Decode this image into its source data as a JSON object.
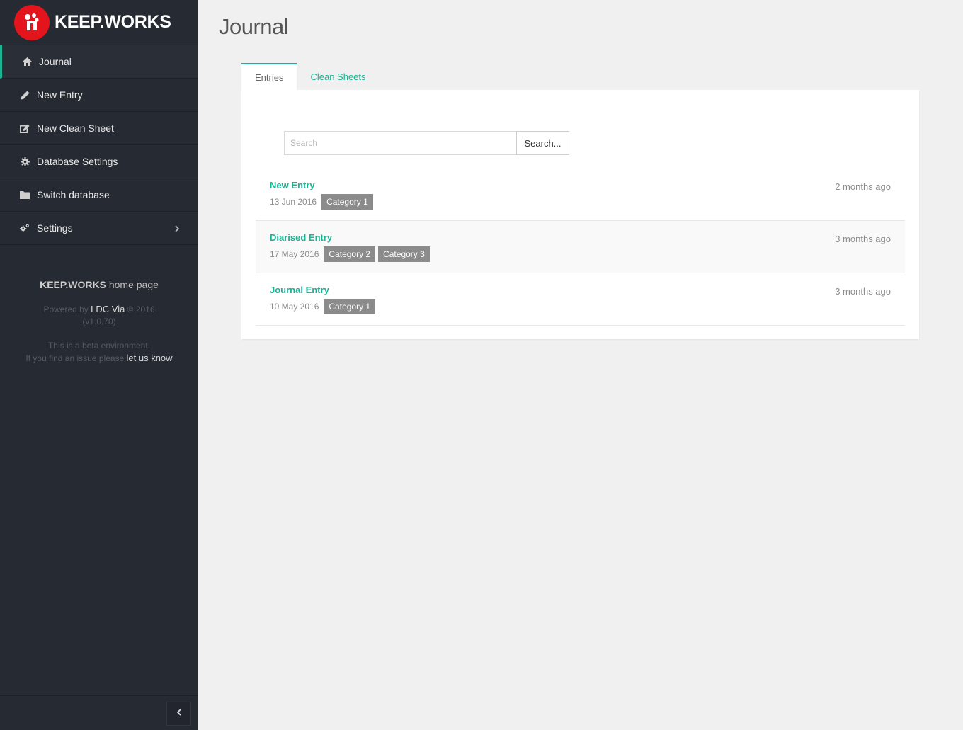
{
  "brand": {
    "name": "KEEP.WORKS"
  },
  "sidebar": {
    "items": [
      {
        "label": "Journal",
        "icon": "home-icon"
      },
      {
        "label": "New Entry",
        "icon": "pencil-icon"
      },
      {
        "label": "New Clean Sheet",
        "icon": "edit-icon"
      },
      {
        "label": "Database Settings",
        "icon": "gear-icon"
      },
      {
        "label": "Switch database",
        "icon": "folder-icon"
      },
      {
        "label": "Settings",
        "icon": "gears-icon"
      }
    ],
    "footer": {
      "home_brand": "KEEP.WORKS",
      "home_text": " home page",
      "powered_prefix": "Powered by ",
      "powered_link": "LDC Via",
      "powered_suffix": " © 2016",
      "version": "(v1.0.70)",
      "beta_line": "This is a beta environment.",
      "issue_prefix": "If you find an issue please ",
      "issue_link": "let us know"
    }
  },
  "main": {
    "title": "Journal",
    "tabs": [
      {
        "label": "Entries",
        "active": true
      },
      {
        "label": "Clean Sheets",
        "active": false
      }
    ],
    "search": {
      "placeholder": "Search",
      "button_label": "Search..."
    },
    "entries": [
      {
        "title": "New Entry",
        "date": "13 Jun 2016",
        "categories": [
          "Category 1"
        ],
        "age": "2 months ago"
      },
      {
        "title": "Diarised Entry",
        "date": "17 May 2016",
        "categories": [
          "Category 2",
          "Category 3"
        ],
        "age": "3 months ago"
      },
      {
        "title": "Journal Entry",
        "date": "10 May 2016",
        "categories": [
          "Category 1"
        ],
        "age": "3 months ago"
      }
    ]
  },
  "colors": {
    "accent": "#1ab394",
    "sidebar_bg": "#262a33",
    "brand_red": "#e3141b",
    "badge_bg": "#8b8b8b",
    "page_bg": "#f0f0f0"
  }
}
